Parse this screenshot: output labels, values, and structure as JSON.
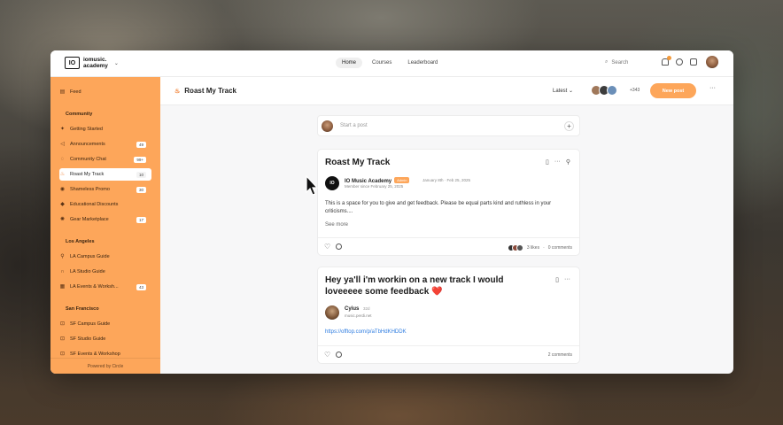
{
  "logo": {
    "mark": "IO",
    "line1": "iomusic.",
    "line2": "academy"
  },
  "topnav": {
    "items": [
      "Home",
      "Courses",
      "Leaderboard"
    ],
    "active": "Home"
  },
  "search": {
    "label": "Search"
  },
  "sidebar": {
    "feed": "Feed",
    "sections": [
      {
        "title": "Community",
        "items": [
          {
            "label": "Getting Started",
            "icon": "lightbulb-icon",
            "count": ""
          },
          {
            "label": "Announcements",
            "icon": "megaphone-icon",
            "count": "49"
          },
          {
            "label": "Community Chat",
            "icon": "chat-icon",
            "count": "99+"
          },
          {
            "label": "Roast My Track",
            "icon": "fire-icon",
            "count": "10",
            "active": true
          },
          {
            "label": "Shameless Promo",
            "icon": "speaker-icon",
            "count": "30"
          },
          {
            "label": "Educational Discounts",
            "icon": "tag-icon",
            "count": ""
          },
          {
            "label": "Gear Marketplace",
            "icon": "gear-icon",
            "count": "17"
          }
        ]
      },
      {
        "title": "Los Angeles",
        "items": [
          {
            "label": "LA Campus Guide",
            "icon": "pin-icon",
            "count": ""
          },
          {
            "label": "LA Studio Guide",
            "icon": "headphones-icon",
            "count": ""
          },
          {
            "label": "LA Events & Worksh...",
            "icon": "calendar-icon",
            "count": "43"
          }
        ]
      },
      {
        "title": "San Francisco",
        "items": [
          {
            "label": "SF Campus Guide",
            "icon": "lock-icon",
            "count": ""
          },
          {
            "label": "SF Studio Guide",
            "icon": "lock-icon",
            "count": ""
          },
          {
            "label": "SF Events & Workshop",
            "icon": "lock-icon",
            "count": ""
          }
        ]
      }
    ],
    "footer": "Powered by Circle"
  },
  "header": {
    "title": "Roast My Track",
    "sort": "Latest",
    "member_count": "+343",
    "new_post": "New post"
  },
  "compose": {
    "placeholder": "Start a post"
  },
  "posts": [
    {
      "title": "Roast My Track",
      "author": "IO Music Academy",
      "author_badge": "Admin",
      "author_sub": "Member since February 25, 2025",
      "meta": "January 8th · Feb 25, 2025",
      "body": "This is a space for you to give and get feedback. Please be equal parts kind and ruthless in your criticisms....",
      "see_more": "See more",
      "likes": "3 likes",
      "comments": "0 comments"
    },
    {
      "title": "Hey ya'll i'm workin on a new track I would loveeeee some feedback ❤️",
      "author": "Cyius",
      "author_time": "32d",
      "author_sub": "music.perdi.net",
      "link": "https://offtop.com/p/aTbHdKHDDK",
      "comments": "2 comments"
    }
  ],
  "colors": {
    "accent": "#fda65a",
    "link": "#2f7de1"
  }
}
